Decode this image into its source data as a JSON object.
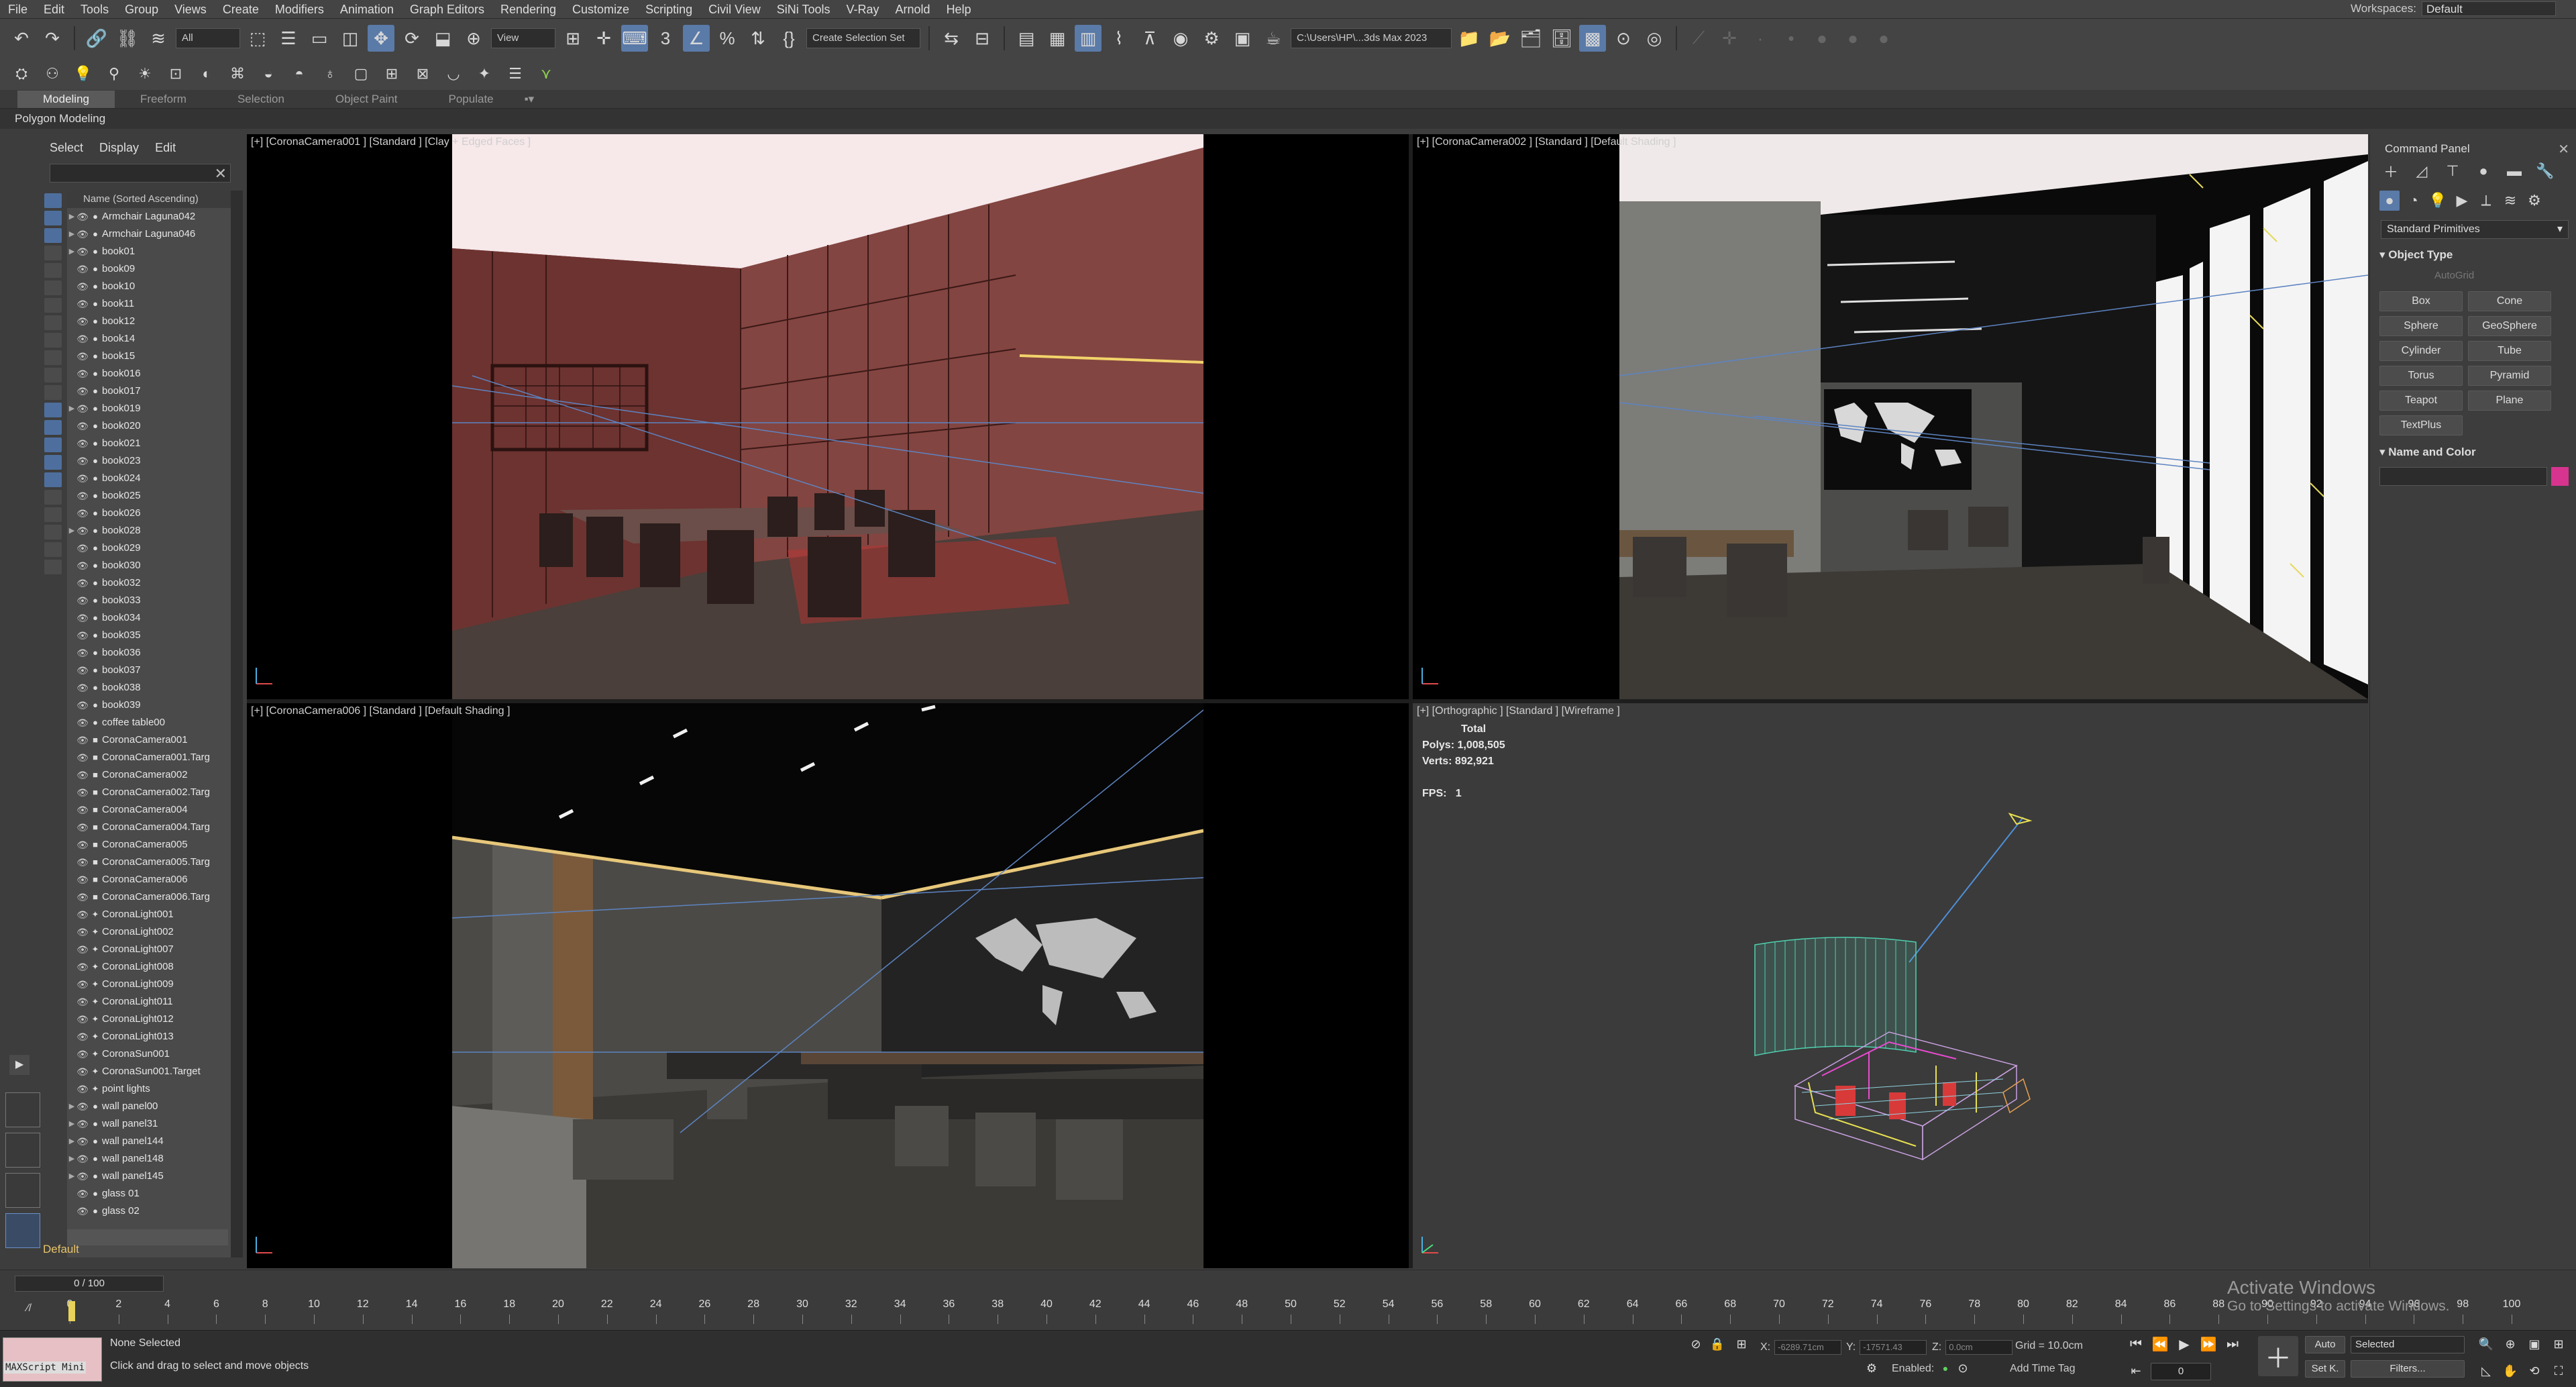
{
  "menubar": {
    "items": [
      "File",
      "Edit",
      "Tools",
      "Group",
      "Views",
      "Create",
      "Modifiers",
      "Animation",
      "Graph Editors",
      "Rendering",
      "Customize",
      "Scripting",
      "Civil View",
      "SiNi Tools",
      "V-Ray",
      "Arnold",
      "Help"
    ],
    "workspace_label": "Workspaces:",
    "workspace_value": "Default"
  },
  "toolbar": {
    "filter_value": "All",
    "view_value": "View",
    "selection_set": "Create Selection Set",
    "project_path": "C:\\Users\\HP\\...3ds Max 2023"
  },
  "ribbon": {
    "tabs": [
      "Modeling",
      "Freeform",
      "Selection",
      "Object Paint",
      "Populate"
    ],
    "active_tab": "Modeling",
    "polygon_modeling": "Polygon Modeling"
  },
  "explorer": {
    "tabs": [
      "Select",
      "Display",
      "Edit"
    ],
    "column_header": "Name (Sorted Ascending)",
    "layer": "Default",
    "items": [
      "Armchair Laguna042",
      "Armchair Laguna046",
      "book01",
      "book09",
      "book10",
      "book11",
      "book12",
      "book14",
      "book15",
      "book016",
      "book017",
      "book019",
      "book020",
      "book021",
      "book023",
      "book024",
      "book025",
      "book026",
      "book028",
      "book029",
      "book030",
      "book032",
      "book033",
      "book034",
      "book035",
      "book036",
      "book037",
      "book038",
      "book039",
      "coffee table00",
      "CoronaCamera001",
      "CoronaCamera001.Targ",
      "CoronaCamera002",
      "CoronaCamera002.Targ",
      "CoronaCamera004",
      "CoronaCamera004.Targ",
      "CoronaCamera005",
      "CoronaCamera005.Targ",
      "CoronaCamera006",
      "CoronaCamera006.Targ",
      "CoronaLight001",
      "CoronaLight002",
      "CoronaLight007",
      "CoronaLight008",
      "CoronaLight009",
      "CoronaLight011",
      "CoronaLight012",
      "CoronaLight013",
      "CoronaSun001",
      "CoronaSun001.Target",
      "point lights",
      "wall panel00",
      "wall panel31",
      "wall panel144",
      "wall panel148",
      "wall panel145",
      "glass 01",
      "glass 02"
    ]
  },
  "viewports": {
    "tl": "[+] [CoronaCamera001 ] [Standard ] [Clay + Edged Faces ]",
    "tr": "[+] [CoronaCamera002 ] [Standard ] [Default Shading ]",
    "bl": "[+] [CoronaCamera006 ] [Standard ] [Default Shading ]",
    "br": "[+] [Orthographic ] [Standard ] [Wireframe ]",
    "stats": {
      "total": "Total",
      "polys_label": "Polys:",
      "polys": "1,008,505",
      "verts_label": "Verts:",
      "verts": "892,921",
      "fps_label": "FPS:",
      "fps": "1"
    }
  },
  "command_panel": {
    "title": "Command Panel",
    "category": "Standard Primitives",
    "object_type": "Object Type",
    "autogrid": "AutoGrid",
    "name_color": "Name and Color",
    "color": "#d6348f",
    "primitives": [
      "Box",
      "Cone",
      "Sphere",
      "GeoSphere",
      "Cylinder",
      "Tube",
      "Torus",
      "Pyramid",
      "Teapot",
      "Plane",
      "TextPlus"
    ]
  },
  "timeline": {
    "frame": "0 / 100",
    "ticks": [
      "0",
      "2",
      "4",
      "6",
      "8",
      "10",
      "12",
      "14",
      "16",
      "18",
      "20",
      "22",
      "24",
      "26",
      "28",
      "30",
      "32",
      "34",
      "36",
      "38",
      "40",
      "42",
      "44",
      "46",
      "48",
      "50",
      "52",
      "54",
      "56",
      "58",
      "60",
      "62",
      "64",
      "66",
      "68",
      "70",
      "72",
      "74",
      "76",
      "78",
      "80",
      "82",
      "84",
      "86",
      "88",
      "90",
      "92",
      "94",
      "96",
      "98",
      "100"
    ]
  },
  "status": {
    "maxscript": "MAXScript Mini",
    "selection": "None Selected",
    "prompt": "Click and drag to select and move objects",
    "x_label": "X:",
    "x_value": "-6289.71cm",
    "y_label": "Y:",
    "y_value": "-17571.43",
    "z_label": "Z:",
    "z_value": "0.0cm",
    "grid": "Grid = 10.0cm",
    "enabled": "Enabled:",
    "add_time_tag": "Add Time Tag",
    "auto": "Auto",
    "selected": "Selected",
    "setk": "Set K.",
    "filters": "Filters...",
    "frame_value": "0",
    "activate_title": "Activate Windows",
    "activate_sub": "Go to Settings to activate Windows."
  }
}
